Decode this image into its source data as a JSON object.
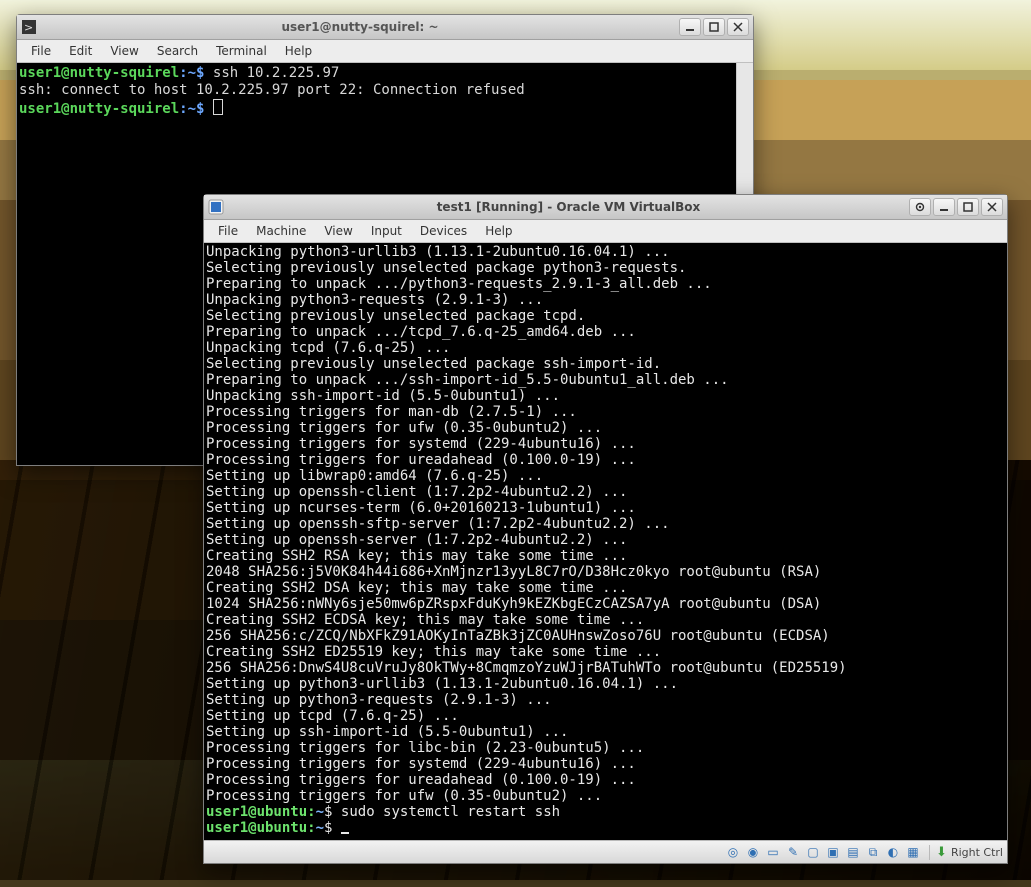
{
  "terminal_window": {
    "title": "user1@nutty-squirel: ~",
    "menu": [
      "File",
      "Edit",
      "View",
      "Search",
      "Terminal",
      "Help"
    ],
    "prompt_userhost": "user1@nutty-squirel",
    "prompt_path": "~",
    "prompt_sigil": "$",
    "lines": {
      "cmd1": "ssh 10.2.225.97",
      "out1": "ssh: connect to host 10.2.225.97 port 22: Connection refused"
    }
  },
  "vbox_window": {
    "title": "test1 [Running] - Oracle VM VirtualBox",
    "menu": [
      "File",
      "Machine",
      "View",
      "Input",
      "Devices",
      "Help"
    ],
    "host_key": "Right Ctrl",
    "status_icons": [
      "disc-icon",
      "optical-icon",
      "floppy-icon",
      "usb-icon",
      "folder-icon",
      "display-icon",
      "clipboard-icon",
      "network-icon",
      "recording-icon",
      "cpu-icon"
    ],
    "console_lines": [
      "Unpacking python3-urllib3 (1.13.1-2ubuntu0.16.04.1) ...",
      "Selecting previously unselected package python3-requests.",
      "Preparing to unpack .../python3-requests_2.9.1-3_all.deb ...",
      "Unpacking python3-requests (2.9.1-3) ...",
      "Selecting previously unselected package tcpd.",
      "Preparing to unpack .../tcpd_7.6.q-25_amd64.deb ...",
      "Unpacking tcpd (7.6.q-25) ...",
      "Selecting previously unselected package ssh-import-id.",
      "Preparing to unpack .../ssh-import-id_5.5-0ubuntu1_all.deb ...",
      "Unpacking ssh-import-id (5.5-0ubuntu1) ...",
      "Processing triggers for man-db (2.7.5-1) ...",
      "Processing triggers for ufw (0.35-0ubuntu2) ...",
      "Processing triggers for systemd (229-4ubuntu16) ...",
      "Processing triggers for ureadahead (0.100.0-19) ...",
      "Setting up libwrap0:amd64 (7.6.q-25) ...",
      "Setting up openssh-client (1:7.2p2-4ubuntu2.2) ...",
      "Setting up ncurses-term (6.0+20160213-1ubuntu1) ...",
      "Setting up openssh-sftp-server (1:7.2p2-4ubuntu2.2) ...",
      "Setting up openssh-server (1:7.2p2-4ubuntu2.2) ...",
      "Creating SSH2 RSA key; this may take some time ...",
      "2048 SHA256:j5V0K84h44i686+XnMjnzr13yyL8C7rO/D38Hcz0kyo root@ubuntu (RSA)",
      "Creating SSH2 DSA key; this may take some time ...",
      "1024 SHA256:nWNy6sje50mw6pZRspxFduKyh9kEZKbgECzCAZSA7yA root@ubuntu (DSA)",
      "Creating SSH2 ECDSA key; this may take some time ...",
      "256 SHA256:c/ZCQ/NbXFkZ91AOKyInTaZBk3jZC0AUHnswZoso76U root@ubuntu (ECDSA)",
      "Creating SSH2 ED25519 key; this may take some time ...",
      "256 SHA256:DnwS4U8cuVruJy8OkTWy+8CmqmzoYzuWJjrBATuhWTo root@ubuntu (ED25519)",
      "Setting up python3-urllib3 (1.13.1-2ubuntu0.16.04.1) ...",
      "Setting up python3-requests (2.9.1-3) ...",
      "Setting up tcpd (7.6.q-25) ...",
      "Setting up ssh-import-id (5.5-0ubuntu1) ...",
      "Processing triggers for libc-bin (2.23-0ubuntu5) ...",
      "Processing triggers for systemd (229-4ubuntu16) ...",
      "Processing triggers for ureadahead (0.100.0-19) ...",
      "Processing triggers for ufw (0.35-0ubuntu2) ..."
    ],
    "prompt_userhost": "user1@ubuntu",
    "prompt_path": "~",
    "prompt_sigil": "$",
    "prompt_cmd1": "sudo systemctl restart ssh"
  }
}
